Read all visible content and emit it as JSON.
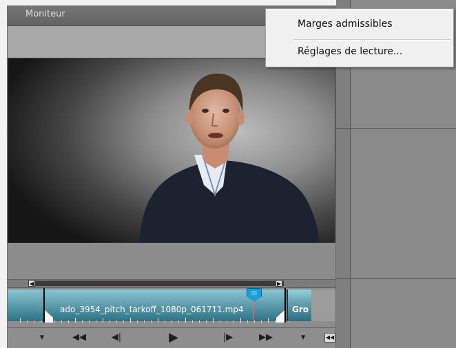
{
  "panel": {
    "title": "Moniteur"
  },
  "context_menu": {
    "items": [
      {
        "label": "Marges admissibles"
      },
      {
        "label": "Réglages de lecture..."
      }
    ]
  },
  "timeline": {
    "clip_name": "ado_3954_pitch_tarkoff_1080p_061711.mp4",
    "next_clip_name": "Gro"
  },
  "icons": {
    "panel_menu": "panel-menu-icon",
    "work_area_start": "work-area-start-icon",
    "work_area_end": "work-area-end-icon",
    "set_in": "set-in-point-icon",
    "rewind": "rewind-icon",
    "step_back": "step-back-icon",
    "play": "play-icon",
    "step_forward": "step-forward-icon",
    "fast_forward": "fast-forward-icon",
    "set_out": "set-out-point-icon",
    "zoom": "zoom-timeline-icon"
  },
  "colors": {
    "clip_teal": "#6aa8b8",
    "playhead": "#1a9fd8",
    "playhead_line": "#ff6a55"
  }
}
